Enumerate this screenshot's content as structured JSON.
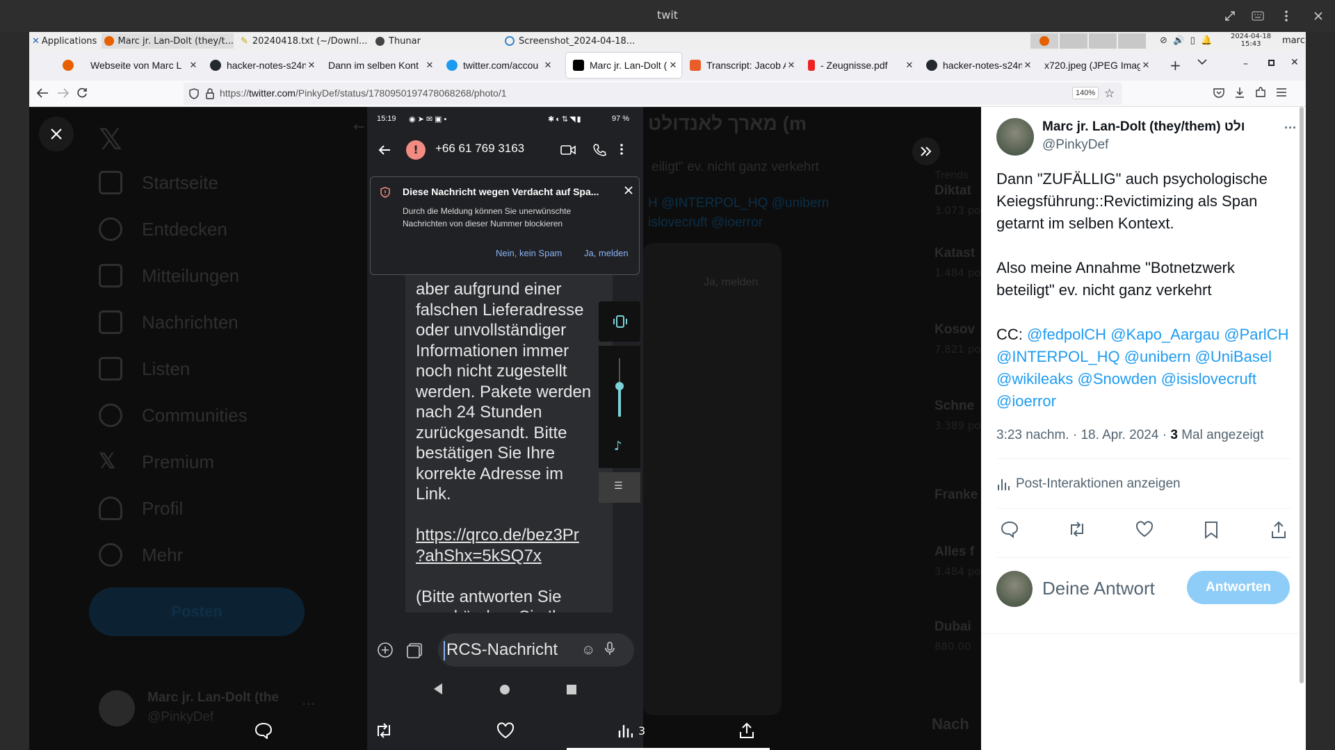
{
  "window": {
    "title": "twit"
  },
  "taskbar": {
    "items": [
      "Applications",
      "Marc jr. Lan-Dolt (they/t...",
      "20240418.txt (~/Downl...",
      "Thunar",
      "Screenshot_2024-04-18..."
    ],
    "clock_date": "2024-04-18",
    "clock_time": "15:43",
    "user": "marc"
  },
  "tabs": [
    {
      "label": "Webseite von Marc L"
    },
    {
      "label": "hacker-notes-s24n"
    },
    {
      "label": "Dann im selben Kont"
    },
    {
      "label": "twitter.com/accou"
    },
    {
      "label": "Marc jr. Lan-Dolt ("
    },
    {
      "label": "Transcript: Jacob A"
    },
    {
      "label": "- Zeugnisse.pdf"
    },
    {
      "label": "hacker-notes-s24n"
    },
    {
      "label": "x720.jpeg (JPEG Imag"
    }
  ],
  "address": {
    "url_prefix": "https://",
    "url_domain": "twitter.com",
    "url_path": "/PinkyDef/status/1780950197478068268/photo/1",
    "zoom": "140%"
  },
  "left_nav": {
    "items": [
      "Startseite",
      "Entdecken",
      "Mitteilungen",
      "Nachrichten",
      "Listen",
      "Communities",
      "Premium",
      "Profil",
      "Mehr"
    ],
    "post_button": "Posten",
    "account_name": "Marc jr. Lan-Dolt (the",
    "account_handle": "@PinkyDef"
  },
  "background_tweet": {
    "title": "מארך לאנדולט (m",
    "line": "eiligt\" ev. nicht ganz verkehrt",
    "mentions_1": "H @INTERPOL_HQ @unibern",
    "mentions_2": "islovecruft @ioerror",
    "dim_button": "Ja, melden",
    "trends_header": "Trends",
    "trend_terms": [
      "Diktat",
      "Katast",
      "Kosov",
      "Schne",
      "Franke",
      "Alles f",
      "Dubai"
    ],
    "trend_counts": [
      "3.073 po",
      "1.484 po",
      "7.821 po",
      "3.389 po",
      "",
      "3.484 po",
      "880.00"
    ],
    "next_header": "Nach"
  },
  "phone": {
    "status_time": "15:19",
    "battery": "97 %",
    "contact": "+66 61 769 3163",
    "spam_title": "Diese Nachricht wegen Verdacht auf Spa...",
    "spam_body": "Durch die Meldung können Sie unerwünschte Nachrichten von dieser Nummer blockieren",
    "spam_no": "Nein, kein Spam",
    "spam_yes": "Ja, melden",
    "message": "aber aufgrund einer\nfalschen Lieferadresse\noder unvollständiger\nInformationen immer\nnoch nicht zugestellt\nwerden. Pakete werden\nnach 24 Stunden\nzurückgesandt. Bitte\nbestätigen Sie Ihre\nkorrekte Adresse im\nLink.",
    "message_link": "https://qrco.de/bez3Pr\n?ahShx=5kSQ7x",
    "message_tail": "(Bitte antworten Sie\nn und ändern Sie Ihre",
    "compose_placeholder": "RCS-Nachricht"
  },
  "tweet": {
    "author_name": "Marc jr. Lan-Dolt (they/them) ולט",
    "author_handle": "@PinkyDef",
    "text_1": "Dann \"ZUFÄLLIG\" auch psychologische Keiegsführung::Revictimizing als Span getarnt im selben Kontext.",
    "text_2": "Also meine Annahme \"Botnetzwerk beteiligt\" ev. nicht ganz verkehrt",
    "cc": "CC:",
    "mentions": [
      "@fedpolCH",
      "@Kapo_Aargau",
      "@ParlCH",
      "@INTERPOL_HQ",
      "@unibern",
      "@UniBasel",
      "@wikileaks",
      "@Snowden",
      "@isislovecruft",
      "@ioerror"
    ],
    "meta_time": "3:23 nachm. · 18. Apr. 2024 ·",
    "views": "3",
    "views_label": "Mal angezeigt",
    "interactions": "Post-Interaktionen anzeigen",
    "reply_placeholder": "Deine Antwort",
    "reply_button": "Antworten"
  },
  "bottom_bar": {
    "views": "3"
  },
  "colors": {
    "link": "#1d9bf0",
    "reply_btn": "#8ecdf8",
    "teal": "#7ad3d8"
  }
}
